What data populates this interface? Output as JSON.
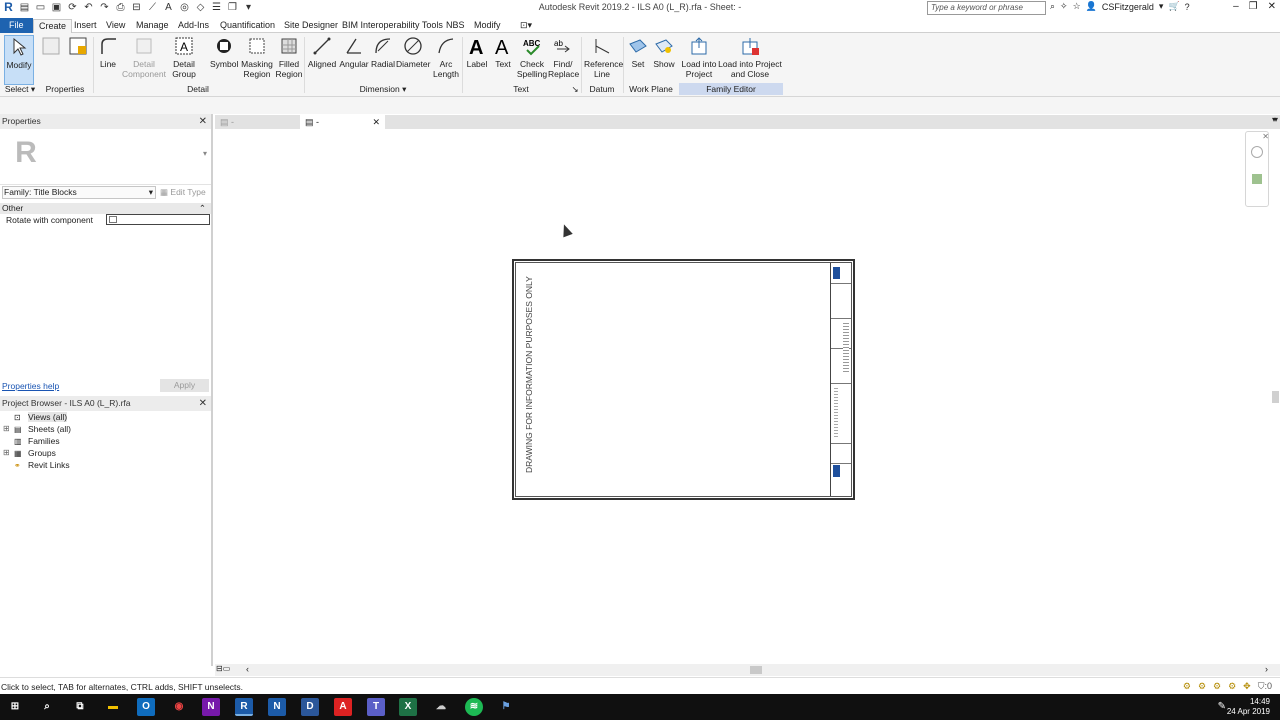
{
  "window": {
    "title": "Autodesk Revit 2019.2 - ILS A0 (L_R).rfa - Sheet: -",
    "search_placeholder": "Type a keyword or phrase",
    "user": "CSFitzgerald"
  },
  "tabs": [
    "File",
    "Create",
    "Insert",
    "View",
    "Manage",
    "Add-Ins",
    "Quantification",
    "Site Designer",
    "BIM Interoperability Tools",
    "NBS",
    "Modify"
  ],
  "active_tab": "Create",
  "ribbon": {
    "buttons": {
      "modify": "Modify",
      "line": "Line",
      "detail_component": "Detail Component",
      "detail_group": "Detail Group",
      "symbol": "Symbol",
      "masking_region": "Masking Region",
      "filled_region": "Filled Region",
      "aligned": "Aligned",
      "angular": "Angular",
      "radial": "Radial",
      "diameter": "Diameter",
      "arc_length": "Arc Length",
      "label": "Label",
      "text": "Text",
      "check_spelling": "Check Spelling",
      "find_replace": "Find/ Replace",
      "reference_line": "Reference Line",
      "set": "Set",
      "show": "Show",
      "load_into_project": "Load into Project",
      "load_into_project_close": "Load into Project and Close"
    },
    "panels": {
      "select": "Select",
      "properties": "Properties",
      "detail": "Detail",
      "dimension": "Dimension",
      "text": "Text",
      "datum": "Datum",
      "work_plane": "Work Plane",
      "family_editor": "Family Editor"
    }
  },
  "properties": {
    "header": "Properties",
    "family": "Family: Title Blocks",
    "edit_type": "Edit Type",
    "category": "Other",
    "param_label": "Rotate with component",
    "param_value": false,
    "help_link": "Properties help",
    "apply": "Apply"
  },
  "browser": {
    "header": "Project Browser - ILS A0 (L_R).rfa",
    "items": [
      {
        "label": "Views (all)",
        "selected": true
      },
      {
        "label": "Sheets (all)"
      },
      {
        "label": "Families"
      },
      {
        "label": "Groups"
      },
      {
        "label": "Revit Links"
      }
    ]
  },
  "view_tabs": [
    {
      "label": "-",
      "active": false
    },
    {
      "label": "-",
      "active": true
    }
  ],
  "sheet": {
    "vertical_text": "DRAWING FOR INFORMATION PURPOSES ONLY"
  },
  "status": {
    "text": "Click to select, TAB for alternates, CTRL adds, SHIFT unselects.",
    "filter_count": ":0"
  },
  "taskbar": {
    "time": "14:49",
    "date": "24 Apr 2019"
  },
  "colors": {
    "file_tab": "#1e63b0",
    "family_editor_panel": "#cdd9ef",
    "modify_active": "#c7dff7"
  }
}
